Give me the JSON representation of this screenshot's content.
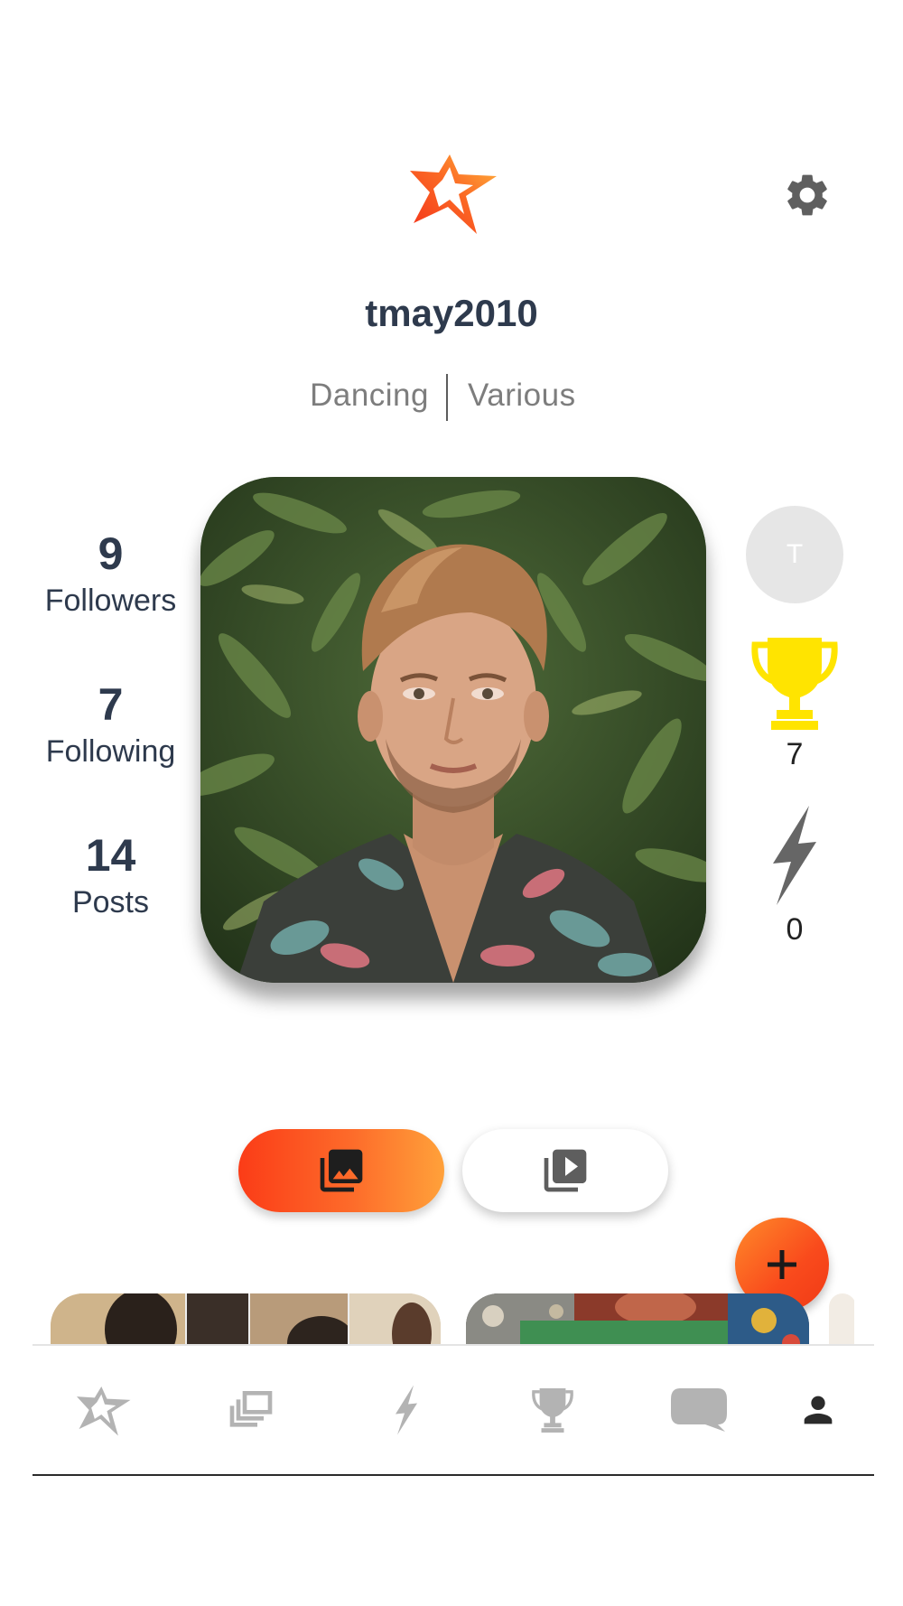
{
  "header": {
    "logo_icon": "star-logo-icon",
    "settings_icon": "gear-icon"
  },
  "profile": {
    "username": "tmay2010",
    "categories": [
      "Dancing",
      "Various"
    ],
    "photo_description_icon": "profile-photo"
  },
  "stats": {
    "followers": {
      "value": "9",
      "label": "Followers"
    },
    "following": {
      "value": "7",
      "label": "Following"
    },
    "posts": {
      "value": "14",
      "label": "Posts"
    }
  },
  "side": {
    "avatar_initial": "T",
    "trophies": "7",
    "bolts": "0"
  },
  "toggle": {
    "photos_icon": "photo-library-icon",
    "videos_icon": "video-library-icon",
    "active": "photos"
  },
  "fab": {
    "label": "+"
  },
  "bottom_nav": [
    "star-icon",
    "gallery-icon",
    "bolt-icon",
    "trophy-icon",
    "chat-icon",
    "person-icon"
  ],
  "colors": {
    "accent_start": "#fb3c17",
    "accent_end": "#ffa13a",
    "trophy": "#ffe400",
    "text_dark": "#2e3a4d"
  }
}
